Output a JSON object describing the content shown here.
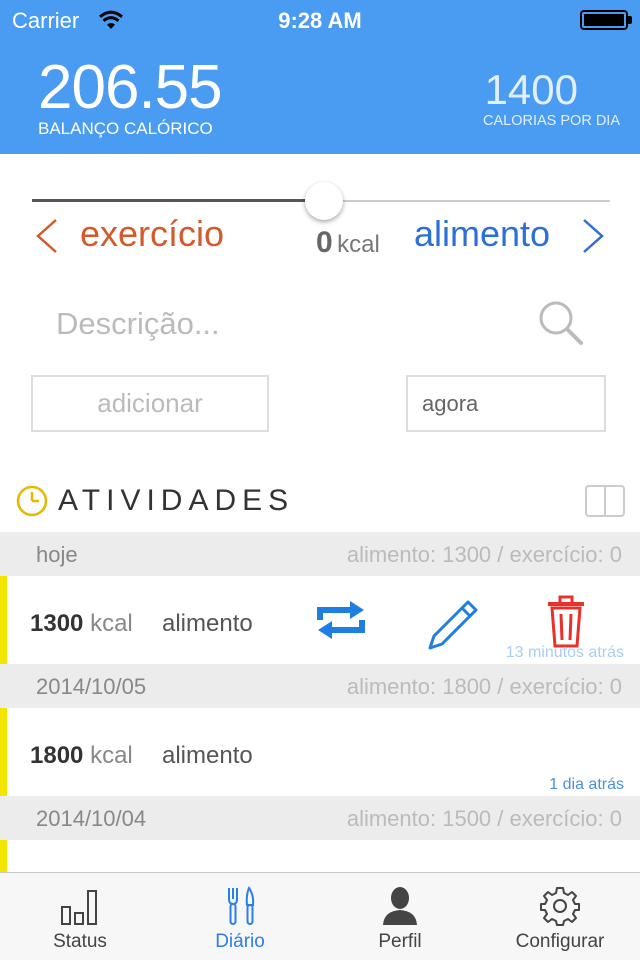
{
  "status_bar": {
    "carrier": "Carrier",
    "time": "9:28 AM"
  },
  "header": {
    "balance_value": "206.55",
    "balance_label": "BALANÇO CALÓRICO",
    "daily_value": "1400",
    "daily_label": "CALORIAS POR DIA"
  },
  "entry_form": {
    "slider_position": 0.5,
    "exercise_label": "exercício",
    "food_label": "alimento",
    "kcal_value": "0",
    "kcal_unit": "kcal",
    "description_placeholder": "Descrição...",
    "add_label": "adicionar",
    "time_value": "agora"
  },
  "activities": {
    "title": "ATIVIDADES",
    "groups": [
      {
        "date": "hoje",
        "summary": "alimento: 1300 / exercício: 0",
        "entries": [
          {
            "value": "1300",
            "unit": "kcal",
            "type": "alimento",
            "time_ago": "13 minutos atrás"
          }
        ]
      },
      {
        "date": "2014/10/05",
        "summary": "alimento: 1800 / exercício: 0",
        "entries": [
          {
            "value": "1800",
            "unit": "kcal",
            "type": "alimento",
            "time_ago": "1 dia atrás"
          }
        ]
      },
      {
        "date": "2014/10/04",
        "summary": "alimento: 1500 / exercício: 0",
        "entries": []
      }
    ]
  },
  "tabbar": {
    "tabs": [
      {
        "label": "Status",
        "icon": "bar-chart-icon"
      },
      {
        "label": "Diário",
        "icon": "fork-knife-icon",
        "active": true
      },
      {
        "label": "Perfil",
        "icon": "person-icon"
      },
      {
        "label": "Configurar",
        "icon": "gear-icon"
      }
    ]
  },
  "colors": {
    "header_bg": "#4a9bf2",
    "exercise": "#d35a2a",
    "food": "#2c6fd6",
    "entry_accent": "#f2e600",
    "delete": "#e8312a",
    "active_tab": "#2b7fe8"
  }
}
